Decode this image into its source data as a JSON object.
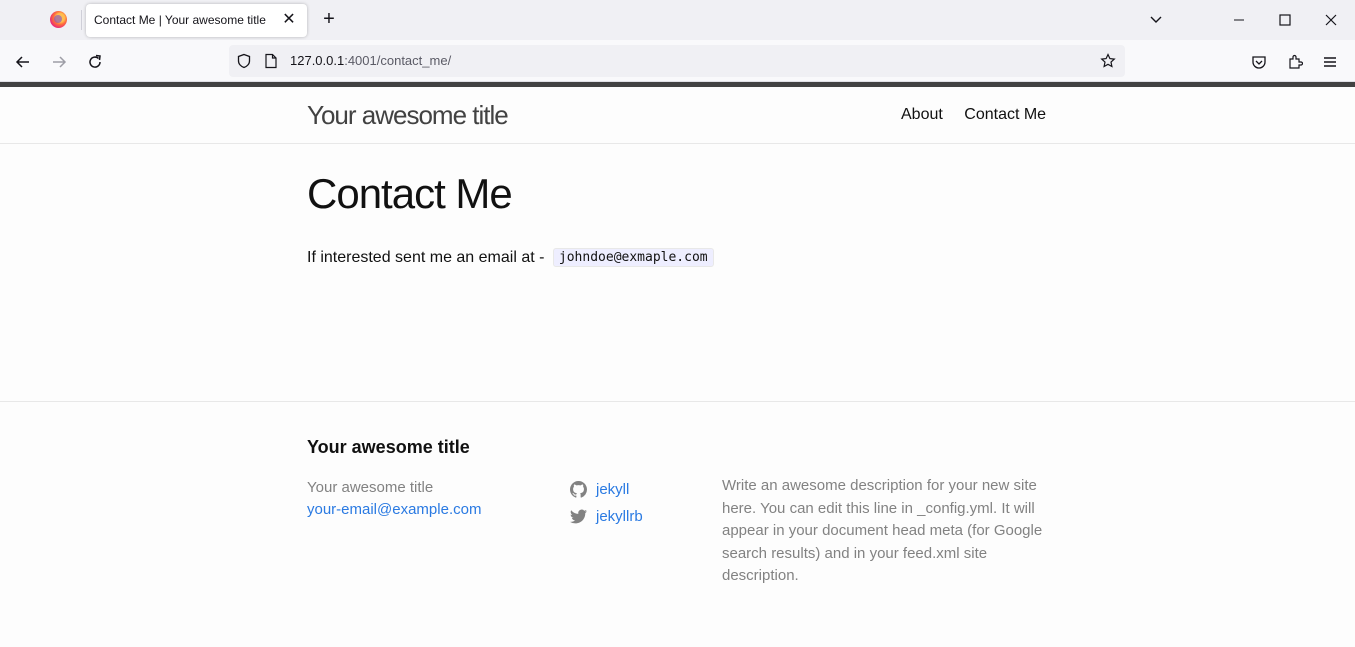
{
  "browser": {
    "tab_title": "Contact Me | Your awesome title",
    "tab_close": "✕",
    "new_tab": "+",
    "url_host": "127.0.0.1",
    "url_path": ":4001/contact_me/"
  },
  "header": {
    "site_title": "Your awesome title",
    "nav": [
      "About",
      "Contact Me"
    ]
  },
  "main": {
    "heading": "Contact Me",
    "intro_text": "If interested sent me an email at -",
    "email": "johndoe@exmaple.com"
  },
  "footer": {
    "heading": "Your awesome title",
    "name": "Your awesome title",
    "email": "your-email@example.com",
    "github": "jekyll",
    "twitter": "jekyllrb",
    "description": "Write an awesome description for your new site here. You can edit this line in _config.yml. It will appear in your document head meta (for Google search results) and in your feed.xml site description."
  },
  "colors": {
    "link": "#2a7ae2",
    "muted_text": "#828282",
    "top_bar": "#424242"
  },
  "icons": [
    "firefox-icon",
    "back-icon",
    "forward-icon",
    "reload-icon",
    "shield-icon",
    "page-icon",
    "star-icon",
    "pocket-icon",
    "extensions-icon",
    "menu-icon",
    "github-icon",
    "twitter-icon"
  ]
}
